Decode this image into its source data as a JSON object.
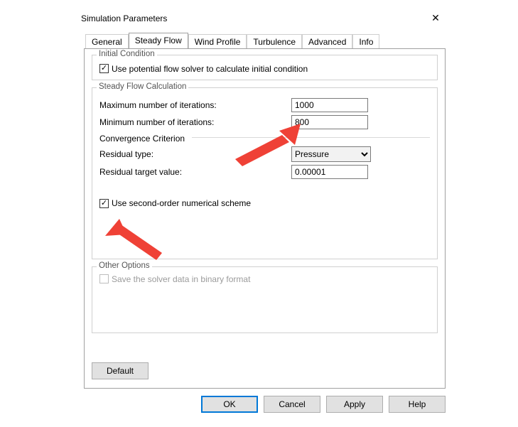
{
  "window": {
    "title": "Simulation Parameters"
  },
  "tabs": [
    {
      "label": "General"
    },
    {
      "label": "Steady Flow"
    },
    {
      "label": "Wind Profile"
    },
    {
      "label": "Turbulence"
    },
    {
      "label": "Advanced"
    },
    {
      "label": "Info"
    }
  ],
  "active_tab": 1,
  "groups": {
    "initial": {
      "legend": "Initial Condition",
      "use_potential_label": "Use potential flow solver to calculate initial condition",
      "use_potential_checked": true
    },
    "steady": {
      "legend": "Steady Flow Calculation",
      "max_iter_label": "Maximum number of iterations:",
      "max_iter_value": "1000",
      "min_iter_label": "Minimum number of iterations:",
      "min_iter_value": "800",
      "convergence_label": "Convergence Criterion",
      "residual_type_label": "Residual type:",
      "residual_type_value": "Pressure",
      "residual_target_label": "Residual target value:",
      "residual_target_value": "0.00001",
      "second_order_label": "Use second-order numerical scheme",
      "second_order_checked": true
    },
    "other": {
      "legend": "Other Options",
      "save_binary_label": "Save the solver data in binary format",
      "save_binary_enabled": false,
      "save_binary_checked": false
    }
  },
  "buttons": {
    "default": "Default",
    "ok": "OK",
    "cancel": "Cancel",
    "apply": "Apply",
    "help": "Help"
  }
}
